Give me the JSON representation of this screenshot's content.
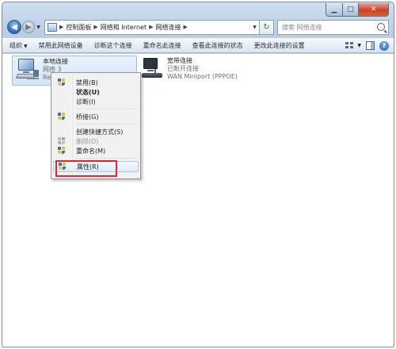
{
  "address": {
    "crumbs": [
      "控制面板",
      "网络和 Internet",
      "网络连接"
    ]
  },
  "search": {
    "placeholder": "搜索 网络连接"
  },
  "toolbar": {
    "items": [
      "组织",
      "禁用此网络设备",
      "诊断这个连接",
      "重命名此连接",
      "查看此连接的状态",
      "更改此连接的设置"
    ]
  },
  "connections": [
    {
      "name": "本地连接",
      "status": "网络 3",
      "device": "Rea"
    },
    {
      "name": "宽带连接",
      "status": "已断开连接",
      "device": "WAN Miniport (PPPOE)"
    }
  ],
  "context_menu": {
    "items": [
      {
        "label": "禁用(B)",
        "shield": true,
        "bold": false,
        "disabled": false
      },
      {
        "label": "状态(U)",
        "shield": false,
        "bold": true,
        "disabled": false
      },
      {
        "label": "诊断(I)",
        "shield": false,
        "bold": false,
        "disabled": false
      },
      {
        "label": "桥接(G)",
        "shield": true,
        "bold": false,
        "disabled": false
      },
      {
        "label": "创建快捷方式(S)",
        "shield": false,
        "bold": false,
        "disabled": false
      },
      {
        "label": "删除(D)",
        "shield": true,
        "bold": false,
        "disabled": true
      },
      {
        "label": "重命名(M)",
        "shield": true,
        "bold": false,
        "disabled": false
      },
      {
        "label": "属性(R)",
        "shield": true,
        "bold": false,
        "disabled": false,
        "highlighted": true
      }
    ]
  },
  "colors": {
    "highlight_box": "#e0262b",
    "selection": "#d3e5f7"
  }
}
